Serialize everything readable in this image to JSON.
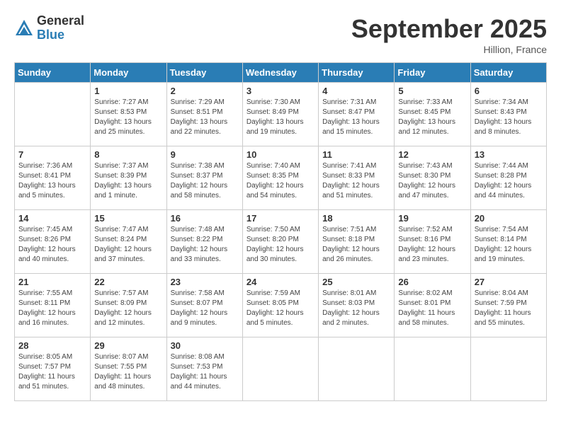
{
  "header": {
    "logo_general": "General",
    "logo_blue": "Blue",
    "month_title": "September 2025",
    "location": "Hillion, France"
  },
  "days_of_week": [
    "Sunday",
    "Monday",
    "Tuesday",
    "Wednesday",
    "Thursday",
    "Friday",
    "Saturday"
  ],
  "weeks": [
    [
      {
        "day": "",
        "info": ""
      },
      {
        "day": "1",
        "info": "Sunrise: 7:27 AM\nSunset: 8:53 PM\nDaylight: 13 hours\nand 25 minutes."
      },
      {
        "day": "2",
        "info": "Sunrise: 7:29 AM\nSunset: 8:51 PM\nDaylight: 13 hours\nand 22 minutes."
      },
      {
        "day": "3",
        "info": "Sunrise: 7:30 AM\nSunset: 8:49 PM\nDaylight: 13 hours\nand 19 minutes."
      },
      {
        "day": "4",
        "info": "Sunrise: 7:31 AM\nSunset: 8:47 PM\nDaylight: 13 hours\nand 15 minutes."
      },
      {
        "day": "5",
        "info": "Sunrise: 7:33 AM\nSunset: 8:45 PM\nDaylight: 13 hours\nand 12 minutes."
      },
      {
        "day": "6",
        "info": "Sunrise: 7:34 AM\nSunset: 8:43 PM\nDaylight: 13 hours\nand 8 minutes."
      }
    ],
    [
      {
        "day": "7",
        "info": "Sunrise: 7:36 AM\nSunset: 8:41 PM\nDaylight: 13 hours\nand 5 minutes."
      },
      {
        "day": "8",
        "info": "Sunrise: 7:37 AM\nSunset: 8:39 PM\nDaylight: 13 hours\nand 1 minute."
      },
      {
        "day": "9",
        "info": "Sunrise: 7:38 AM\nSunset: 8:37 PM\nDaylight: 12 hours\nand 58 minutes."
      },
      {
        "day": "10",
        "info": "Sunrise: 7:40 AM\nSunset: 8:35 PM\nDaylight: 12 hours\nand 54 minutes."
      },
      {
        "day": "11",
        "info": "Sunrise: 7:41 AM\nSunset: 8:33 PM\nDaylight: 12 hours\nand 51 minutes."
      },
      {
        "day": "12",
        "info": "Sunrise: 7:43 AM\nSunset: 8:30 PM\nDaylight: 12 hours\nand 47 minutes."
      },
      {
        "day": "13",
        "info": "Sunrise: 7:44 AM\nSunset: 8:28 PM\nDaylight: 12 hours\nand 44 minutes."
      }
    ],
    [
      {
        "day": "14",
        "info": "Sunrise: 7:45 AM\nSunset: 8:26 PM\nDaylight: 12 hours\nand 40 minutes."
      },
      {
        "day": "15",
        "info": "Sunrise: 7:47 AM\nSunset: 8:24 PM\nDaylight: 12 hours\nand 37 minutes."
      },
      {
        "day": "16",
        "info": "Sunrise: 7:48 AM\nSunset: 8:22 PM\nDaylight: 12 hours\nand 33 minutes."
      },
      {
        "day": "17",
        "info": "Sunrise: 7:50 AM\nSunset: 8:20 PM\nDaylight: 12 hours\nand 30 minutes."
      },
      {
        "day": "18",
        "info": "Sunrise: 7:51 AM\nSunset: 8:18 PM\nDaylight: 12 hours\nand 26 minutes."
      },
      {
        "day": "19",
        "info": "Sunrise: 7:52 AM\nSunset: 8:16 PM\nDaylight: 12 hours\nand 23 minutes."
      },
      {
        "day": "20",
        "info": "Sunrise: 7:54 AM\nSunset: 8:14 PM\nDaylight: 12 hours\nand 19 minutes."
      }
    ],
    [
      {
        "day": "21",
        "info": "Sunrise: 7:55 AM\nSunset: 8:11 PM\nDaylight: 12 hours\nand 16 minutes."
      },
      {
        "day": "22",
        "info": "Sunrise: 7:57 AM\nSunset: 8:09 PM\nDaylight: 12 hours\nand 12 minutes."
      },
      {
        "day": "23",
        "info": "Sunrise: 7:58 AM\nSunset: 8:07 PM\nDaylight: 12 hours\nand 9 minutes."
      },
      {
        "day": "24",
        "info": "Sunrise: 7:59 AM\nSunset: 8:05 PM\nDaylight: 12 hours\nand 5 minutes."
      },
      {
        "day": "25",
        "info": "Sunrise: 8:01 AM\nSunset: 8:03 PM\nDaylight: 12 hours\nand 2 minutes."
      },
      {
        "day": "26",
        "info": "Sunrise: 8:02 AM\nSunset: 8:01 PM\nDaylight: 11 hours\nand 58 minutes."
      },
      {
        "day": "27",
        "info": "Sunrise: 8:04 AM\nSunset: 7:59 PM\nDaylight: 11 hours\nand 55 minutes."
      }
    ],
    [
      {
        "day": "28",
        "info": "Sunrise: 8:05 AM\nSunset: 7:57 PM\nDaylight: 11 hours\nand 51 minutes."
      },
      {
        "day": "29",
        "info": "Sunrise: 8:07 AM\nSunset: 7:55 PM\nDaylight: 11 hours\nand 48 minutes."
      },
      {
        "day": "30",
        "info": "Sunrise: 8:08 AM\nSunset: 7:53 PM\nDaylight: 11 hours\nand 44 minutes."
      },
      {
        "day": "",
        "info": ""
      },
      {
        "day": "",
        "info": ""
      },
      {
        "day": "",
        "info": ""
      },
      {
        "day": "",
        "info": ""
      }
    ]
  ]
}
